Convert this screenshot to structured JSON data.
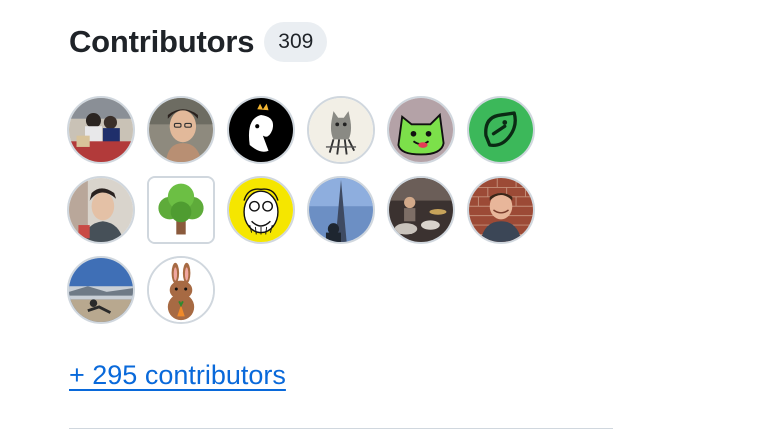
{
  "contributors": {
    "title": "Contributors",
    "count": "309",
    "more_link": "+ 295 contributors",
    "avatars": [
      {
        "icon": "photo-people-avatar"
      },
      {
        "icon": "photo-face-avatar"
      },
      {
        "icon": "ghost-crown-avatar"
      },
      {
        "icon": "cat-sketch-avatar"
      },
      {
        "icon": "green-cat-avatar"
      },
      {
        "icon": "green-leaf-logo-avatar"
      },
      {
        "icon": "photo-portrait-avatar"
      },
      {
        "icon": "tree-avatar"
      },
      {
        "icon": "cartoon-face-yellow-avatar"
      },
      {
        "icon": "photo-tower-avatar"
      },
      {
        "icon": "photo-drummer-avatar"
      },
      {
        "icon": "photo-brick-wall-man-avatar"
      },
      {
        "icon": "photo-landscape-avatar"
      },
      {
        "icon": "rabbit-avatar"
      }
    ]
  }
}
